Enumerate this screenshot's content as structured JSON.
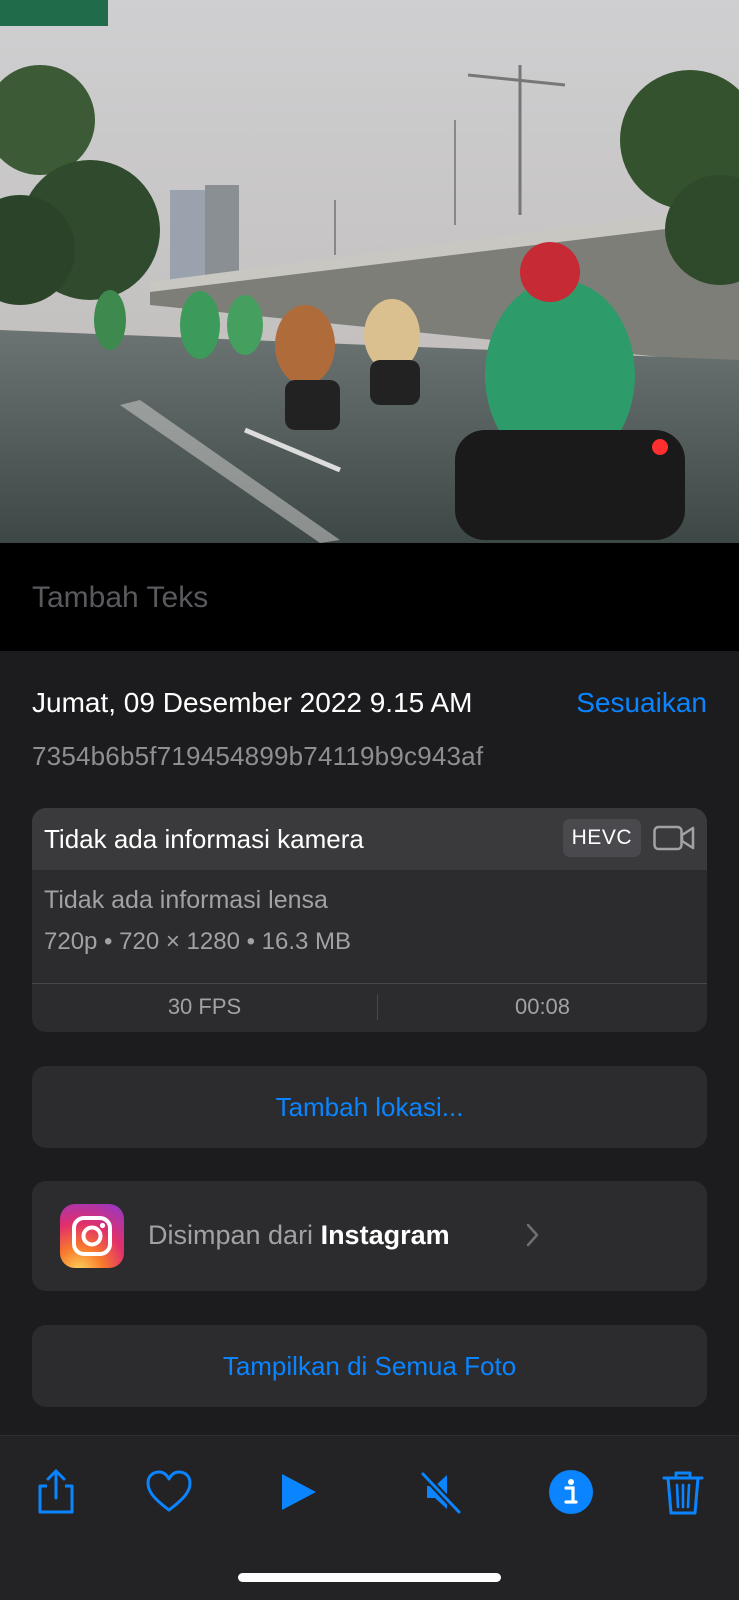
{
  "photo": {
    "description_icon": "rainy-road-photo"
  },
  "caption": {
    "placeholder": "Tambah Teks"
  },
  "info": {
    "datetime": "Jumat, 09 Desember 2022 9.15 AM",
    "adjust_label": "Sesuaikan",
    "filename": "7354b6b5f719454899b74119b9c943af"
  },
  "camera": {
    "title": "Tidak ada informasi kamera",
    "codec": "HEVC",
    "lens": "Tidak ada informasi lensa",
    "specs": "720p  •  720 × 1280  •  16.3 MB",
    "fps": "30 FPS",
    "duration": "00:08"
  },
  "location": {
    "add_label": "Tambah lokasi..."
  },
  "source": {
    "prefix": "Disimpan dari ",
    "app": "Instagram"
  },
  "show_all": {
    "label": "Tampilkan di Semua Foto"
  },
  "toolbar": {
    "icons": [
      "share-icon",
      "heart-icon",
      "play-icon",
      "mute-icon",
      "info-icon",
      "trash-icon"
    ],
    "accent": "#0a84ff"
  },
  "colors": {
    "accent": "#0a84ff",
    "background": "#1c1c1e",
    "card": "#2c2c2e"
  }
}
